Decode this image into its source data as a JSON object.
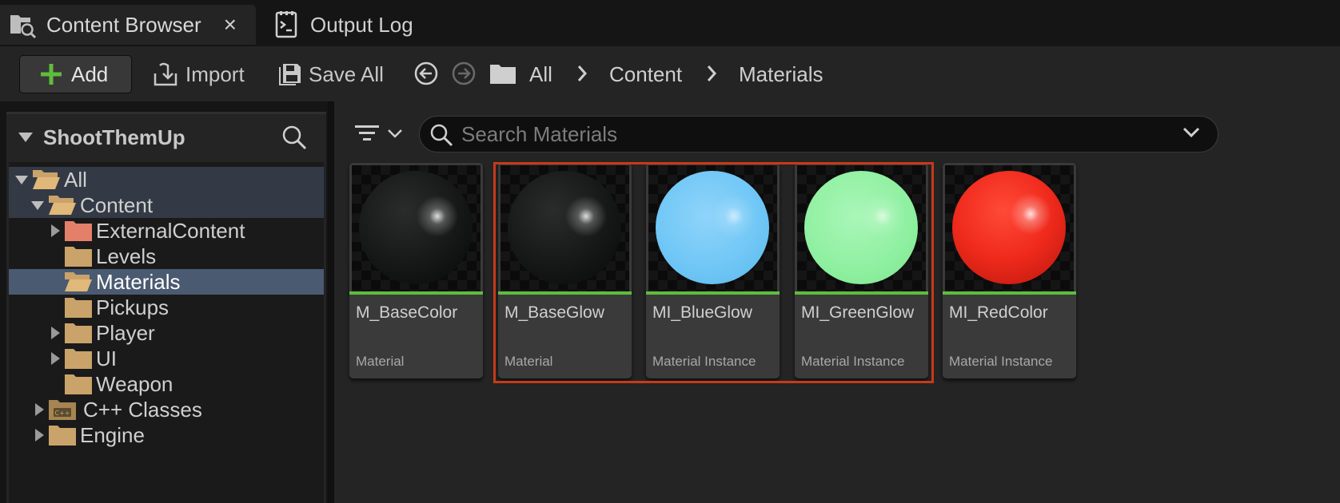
{
  "tabs": [
    {
      "label": "Content Browser",
      "icon": "content-browser-icon",
      "active": true,
      "close": "×"
    },
    {
      "label": "Output Log",
      "icon": "output-log-icon",
      "active": false
    }
  ],
  "toolbar": {
    "add_label": "Add",
    "import_label": "Import",
    "save_all_label": "Save All",
    "breadcrumb": [
      "All",
      "Content",
      "Materials"
    ],
    "accent_green": "#5fbd3c"
  },
  "left_panel": {
    "title": "ShootThemUp",
    "tree": [
      {
        "label": "All",
        "expanded": true
      },
      {
        "label": "Content",
        "expanded": true
      },
      {
        "label": "ExternalContent",
        "expanded": false
      },
      {
        "label": "Levels"
      },
      {
        "label": "Materials",
        "selected": true
      },
      {
        "label": "Pickups"
      },
      {
        "label": "Player",
        "expanded": false
      },
      {
        "label": "UI",
        "expanded": false
      },
      {
        "label": "Weapon"
      },
      {
        "label": "C++ Classes",
        "expanded": false
      },
      {
        "label": "Engine",
        "expanded": false
      }
    ]
  },
  "search": {
    "placeholder": "Search Materials"
  },
  "assets": [
    {
      "name": "M_BaseColor",
      "type": "Material",
      "color": "#1a1a1a"
    },
    {
      "name": "M_BaseGlow",
      "type": "Material",
      "color": "#1a1a1a"
    },
    {
      "name": "MI_BlueGlow",
      "type": "Material Instance",
      "color": "#6ec6f5"
    },
    {
      "name": "MI_GreenGlow",
      "type": "Material Instance",
      "color": "#8ef0a0"
    },
    {
      "name": "MI_RedColor",
      "type": "Material Instance",
      "color": "#ef2a1c"
    }
  ],
  "selection_color": "#c53a1a"
}
